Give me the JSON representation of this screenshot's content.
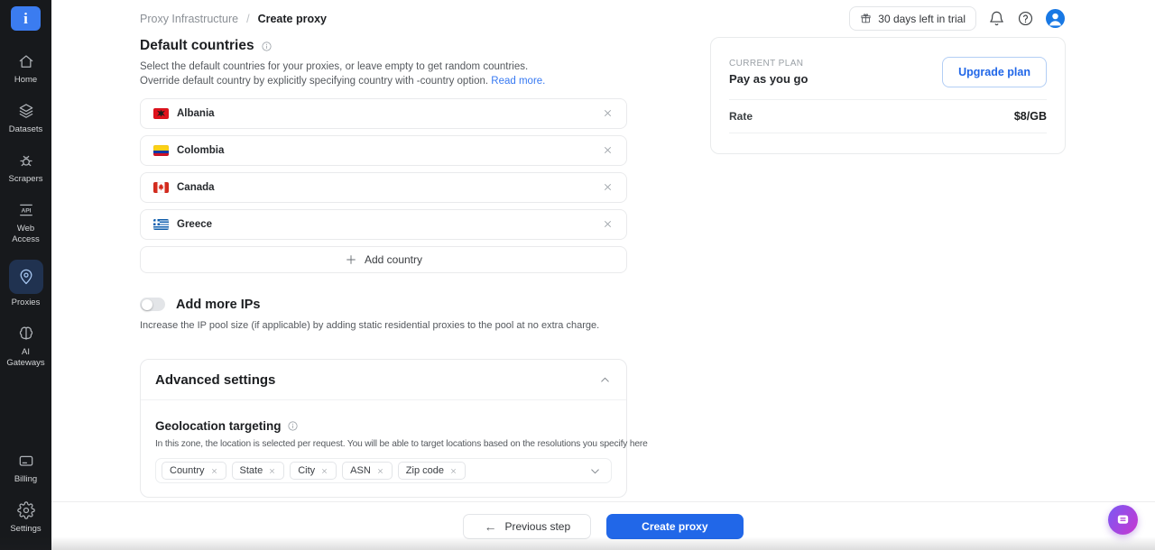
{
  "colors": {
    "accent_blue": "#2167e8",
    "link_blue": "#3779f2",
    "sidebar_bg": "#17191c",
    "active_item_bg": "#203250",
    "logo_blue": "#3b7cf0",
    "avatar_blue": "#1878e4",
    "chat_gradient_start": "#7e57f2",
    "chat_gradient_end": "#c438d2",
    "card_border": "#e9eaec"
  },
  "sidebar": {
    "logo_letter": "i",
    "items": [
      {
        "id": "home",
        "label": "Home",
        "icon": "home-icon",
        "active": false,
        "group": "top"
      },
      {
        "id": "datasets",
        "label": "Datasets",
        "icon": "datasets-icon",
        "active": false,
        "group": "top"
      },
      {
        "id": "scrapers",
        "label": "Scrapers",
        "icon": "scrapers-icon",
        "active": false,
        "group": "top"
      },
      {
        "id": "web-access",
        "label": "Web Access",
        "icon": "api-icon",
        "active": false,
        "group": "top"
      },
      {
        "id": "proxies",
        "label": "Proxies",
        "icon": "map-pin-icon",
        "active": true,
        "group": "top"
      },
      {
        "id": "ai-gateways",
        "label": "AI Gateways",
        "icon": "brain-icon",
        "active": false,
        "group": "top"
      },
      {
        "id": "billing",
        "label": "Billing",
        "icon": "credit-card-icon",
        "active": false,
        "group": "bottom"
      },
      {
        "id": "settings",
        "label": "Settings",
        "icon": "gear-icon",
        "active": false,
        "group": "bottom"
      }
    ]
  },
  "header": {
    "breadcrumb": {
      "section": "Proxy Infrastructure",
      "separator": "/",
      "page": "Create proxy"
    },
    "trial_badge": "30 days left in trial",
    "icons": [
      "gift-icon",
      "bell-icon",
      "help-icon",
      "user-avatar-icon"
    ]
  },
  "main": {
    "default_countries": {
      "title": "Default countries",
      "description_line1": "Select the default countries for your proxies, or leave empty to get random countries.",
      "description_line2": "Override default country by explicitly specifying country with -country option.",
      "read_more": "Read more.",
      "countries": [
        {
          "name": "Albania",
          "flag": "al"
        },
        {
          "name": "Colombia",
          "flag": "co"
        },
        {
          "name": "Canada",
          "flag": "ca"
        },
        {
          "name": "Greece",
          "flag": "gr"
        }
      ],
      "add_button": "Add country"
    },
    "add_more_ips": {
      "title": "Add more IPs",
      "toggle_on": false,
      "description": "Increase the IP pool size (if applicable) by adding static residential proxies to the pool at no extra charge."
    },
    "advanced_settings": {
      "title": "Advanced settings",
      "expanded": true,
      "geolocation": {
        "title": "Geolocation targeting",
        "description": "In this zone, the location is selected per request. You will be able to target locations based on the resolutions you specify here",
        "tags": [
          "Country",
          "State",
          "City",
          "ASN",
          "Zip code"
        ]
      }
    }
  },
  "plan_card": {
    "label": "CURRENT PLAN",
    "name": "Pay as you go",
    "upgrade_button": "Upgrade plan",
    "rate_label": "Rate",
    "rate_value": "$8/GB"
  },
  "footer": {
    "previous_button": "Previous step",
    "create_button": "Create proxy"
  },
  "chat_button": {
    "icon": "chat-icon"
  }
}
